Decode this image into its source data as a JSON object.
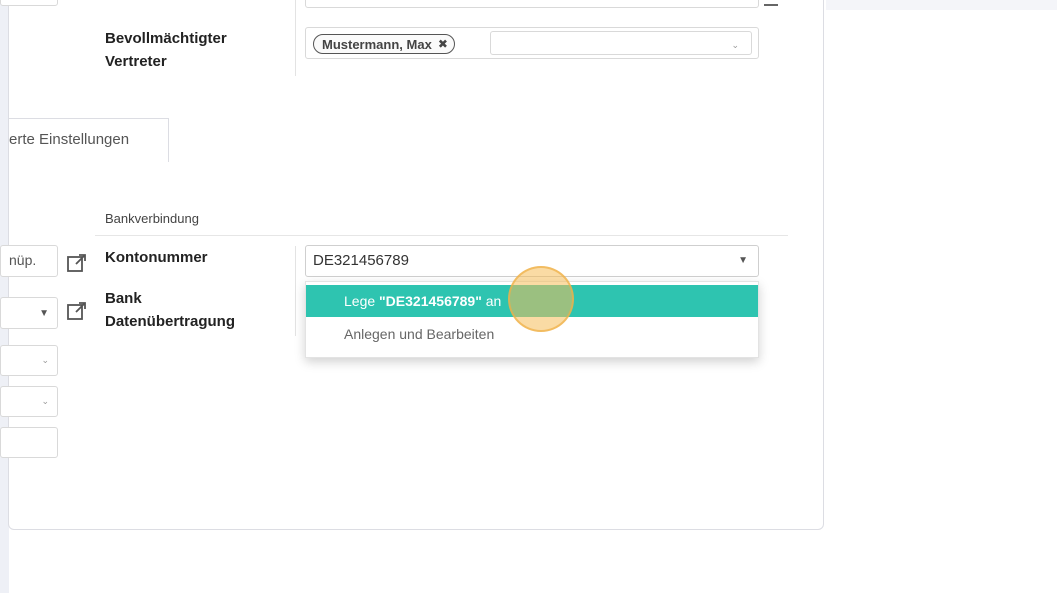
{
  "form": {
    "representative_label_line1": "Bevollmächtigter",
    "representative_label_line2": "Vertreter",
    "representative_tag": "Mustermann, Max",
    "tab_label": "erte Einstellungen",
    "section_title": "Bankverbindung",
    "account_label": "Kontonummer",
    "account_value": "DE321456789",
    "bank_label_line1": "Bank",
    "bank_label_line2": "Datenübertragung",
    "left_partial_input_text": "nüp."
  },
  "dropdown": {
    "create_prefix": "Lege ",
    "create_value": "\"DE321456789\"",
    "create_suffix": " an",
    "create_and_edit": "Anlegen und Bearbeiten"
  },
  "colors": {
    "accent": "#2ec4b0",
    "cursor_highlight": "#f6be5a"
  },
  "icons": {
    "tag_remove": "close-icon",
    "external_link": "external-link-icon",
    "dropdown_caret": "caret-down-icon"
  }
}
